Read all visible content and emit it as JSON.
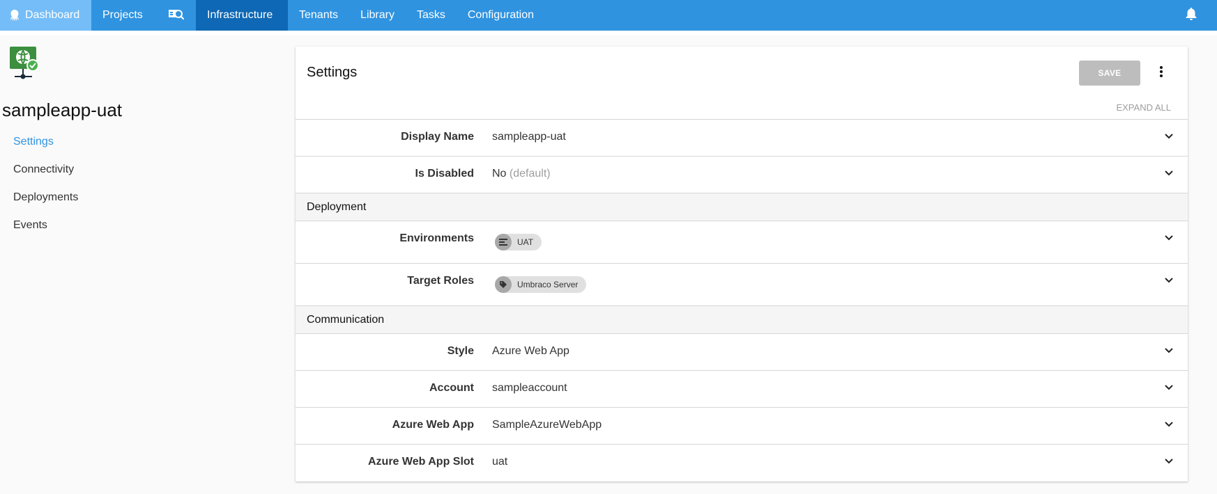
{
  "nav": {
    "items": [
      {
        "label": "Dashboard",
        "icon": "octopus-icon"
      },
      {
        "label": "Projects"
      },
      {
        "label": "",
        "icon": "search-machines-icon"
      },
      {
        "label": "Infrastructure",
        "active": true
      },
      {
        "label": "Tenants"
      },
      {
        "label": "Library"
      },
      {
        "label": "Tasks"
      },
      {
        "label": "Configuration"
      }
    ],
    "notification_icon": "bell-icon"
  },
  "sidebar": {
    "machine_icon": "azure-web-app-healthy-icon",
    "machine_name": "sampleapp-uat",
    "links": [
      {
        "label": "Settings",
        "active": true
      },
      {
        "label": "Connectivity"
      },
      {
        "label": "Deployments"
      },
      {
        "label": "Events"
      }
    ]
  },
  "card": {
    "title": "Settings",
    "save_label": "SAVE",
    "expand_all_label": "EXPAND ALL",
    "rows": {
      "display_name": {
        "label": "Display Name",
        "value": "sampleapp-uat"
      },
      "is_disabled": {
        "label": "Is Disabled",
        "value": "No",
        "hint": "(default)"
      }
    },
    "sections": {
      "deployment": {
        "title": "Deployment",
        "environments": {
          "label": "Environments",
          "chip": "UAT",
          "chip_icon": "environment-icon"
        },
        "target_roles": {
          "label": "Target Roles",
          "chip": "Umbraco Server",
          "chip_icon": "tag-icon"
        }
      },
      "communication": {
        "title": "Communication",
        "style": {
          "label": "Style",
          "value": "Azure Web App"
        },
        "account": {
          "label": "Account",
          "value": "sampleaccount"
        },
        "web_app": {
          "label": "Azure Web App",
          "value": "SampleAzureWebApp"
        },
        "web_app_slot": {
          "label": "Azure Web App Slot",
          "value": "uat"
        }
      }
    }
  },
  "colors": {
    "nav_bg": "#2f93e0",
    "nav_dashboard_bg": "#74bdf8",
    "nav_active_bg": "#0e68b5",
    "link_active": "#2f93e0",
    "save_disabled": "#bdbdbd"
  }
}
